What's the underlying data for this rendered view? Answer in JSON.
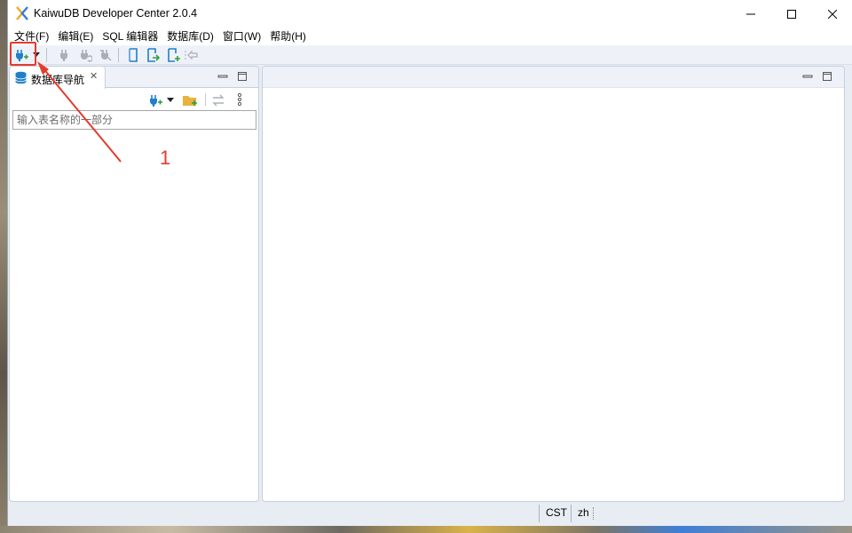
{
  "window": {
    "title": "KaiwuDB Developer Center 2.0.4",
    "controls": {
      "minimize": "minimize-icon",
      "maximize": "maximize-icon",
      "close": "close-icon"
    }
  },
  "menubar": {
    "items": [
      "文件(F)",
      "编辑(E)",
      "SQL 编辑器",
      "数据库(D)",
      "窗口(W)",
      "帮助(H)"
    ]
  },
  "toolbar": {
    "icons": [
      "new-connection-icon",
      "dropdown-arrow-icon",
      "connect-icon",
      "disconnect-icon",
      "invalidate-icon",
      "sql-editor-icon",
      "open-sql-script-icon",
      "new-sql-script-icon",
      "commit-mode-icon"
    ]
  },
  "navigator": {
    "tab_label": "数据库导航",
    "search": {
      "placeholder": "输入表名称的一部分",
      "value": ""
    },
    "tools": [
      "new-connection-icon",
      "dropdown-arrow-icon",
      "new-folder-icon",
      "link-with-editor-icon",
      "more-options-icon"
    ]
  },
  "statusbar": {
    "timezone": "CST",
    "locale": "zh"
  },
  "annotation": {
    "label": "1",
    "color": "#e33b2e"
  },
  "colors": {
    "accent_blue": "#1f7fc9",
    "window_bg": "#e8edf4",
    "annotation_red": "#e33b2e"
  }
}
